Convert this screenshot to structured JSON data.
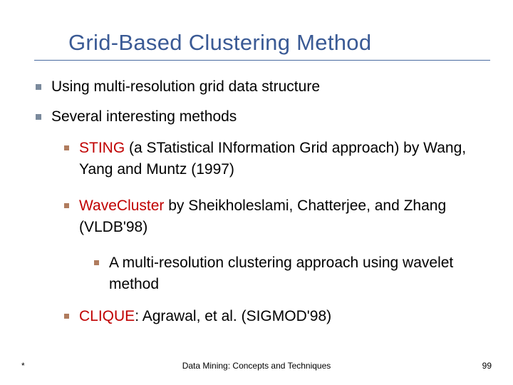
{
  "title": "Grid-Based Clustering Method",
  "bullets": {
    "l1a": "Using multi-resolution grid data structure",
    "l1b": "Several interesting methods",
    "sting_key": "STING",
    "sting_rest": " (a STatistical INformation Grid approach) by Wang, Yang and Muntz (1997)",
    "wave_key": "WaveCluster",
    "wave_rest": " by Sheikholeslami, Chatterjee, and Zhang (VLDB'98)",
    "wave_sub": "A multi-resolution clustering approach using wavelet method",
    "clique_key": "CLIQUE",
    "clique_rest": ": Agrawal, et al. (SIGMOD'98)"
  },
  "footer": {
    "left": "*",
    "center": "Data Mining: Concepts and Techniques",
    "page": "99"
  }
}
